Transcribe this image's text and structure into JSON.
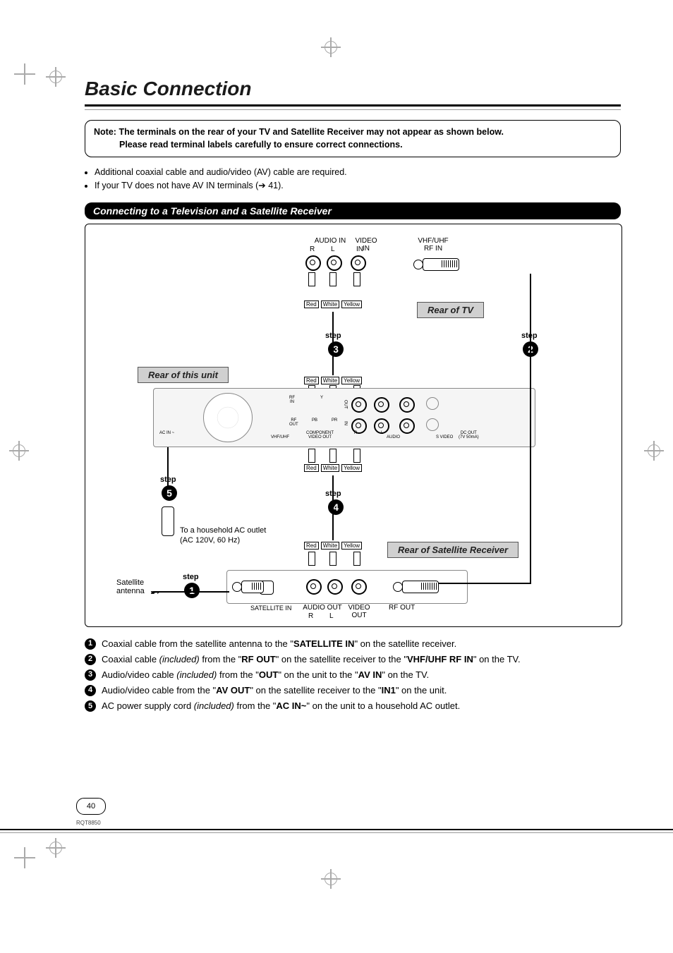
{
  "title": "Basic Connection",
  "note": {
    "prefix": "Note:",
    "line1": "The terminals on the rear of your TV and Satellite Receiver may not appear as shown below.",
    "line2": "Please read terminal labels carefully to ensure correct connections."
  },
  "bullets": [
    "Additional coaxial cable and audio/video (AV) cable are required.",
    "If your TV does not have AV IN terminals (➔ 41)."
  ],
  "section_bar": "Connecting to a Television and a Satellite Receiver",
  "diagram": {
    "tv_label": "Rear of TV",
    "unit_label": "Rear of this unit",
    "sat_label": "Rear of Satellite Receiver",
    "audio_in": "AUDIO IN",
    "video_in": "VIDEO\nIN",
    "r": "R",
    "l": "L",
    "in": "IN",
    "vhf_uhf_rf_in": "VHF/UHF\nRF IN",
    "red": "Red",
    "white": "White",
    "yellow": "Yellow",
    "step": "step",
    "step1": "1",
    "step2": "2",
    "step3": "3",
    "step4": "4",
    "step5": "5",
    "ac_outlet_line1": "To a household AC outlet",
    "ac_outlet_line2": "(AC 120V, 60 Hz)",
    "satellite_antenna": "Satellite\nantenna",
    "satellite_in": "SATELLITE IN",
    "audio_out": "AUDIO OUT",
    "video_out": "VIDEO\nOUT",
    "rf_out": "RF OUT",
    "audio": "AUDIO",
    "s_video": "S VIDEO",
    "vhf_uhf": "VHF/UHF",
    "ac_in": "AC IN ~",
    "rf_in_small": "RF\nIN",
    "rf_out_small": "RF\nOUT",
    "out": "OUT",
    "in_small": "IN",
    "r_small": "R",
    "l_small": "L",
    "pb": "PB",
    "pr": "PR",
    "y": "Y",
    "component_out": "COMPONENT\nVIDEO OUT",
    "dc_out": "DC OUT\n(7V 50mA)"
  },
  "steps": [
    {
      "n": "1",
      "pre": "Coaxial cable from the satellite antenna to the \"",
      "b1": "SATELLITE IN",
      "mid": "\" on the satellite receiver.",
      "b2": "",
      "suf": ""
    },
    {
      "n": "2",
      "pre": "Coaxial cable ",
      "i1": "(included)",
      "mid1": " from the \"",
      "b1": "RF OUT",
      "mid2": "\" on the satellite receiver to the \"",
      "b2": "VHF/UHF RF IN",
      "suf": "\" on the TV."
    },
    {
      "n": "3",
      "pre": "Audio/video cable ",
      "i1": "(included)",
      "mid1": " from the \"",
      "b1": "OUT",
      "mid2": "\" on the unit to the \"",
      "b2": "AV IN",
      "suf": "\" on the TV."
    },
    {
      "n": "4",
      "pre": "Audio/video cable from the \"",
      "b1": "AV OUT",
      "mid": "\" on the satellite receiver to the \"",
      "b2": "IN1",
      "suf": "\" on the unit."
    },
    {
      "n": "5",
      "pre": "AC power supply cord ",
      "i1": "(included)",
      "mid1": " from the \"",
      "b1": "AC IN~",
      "suf": "\" on the unit to a household AC outlet."
    }
  ],
  "page_number": "40",
  "footer_code": "RQT8850"
}
